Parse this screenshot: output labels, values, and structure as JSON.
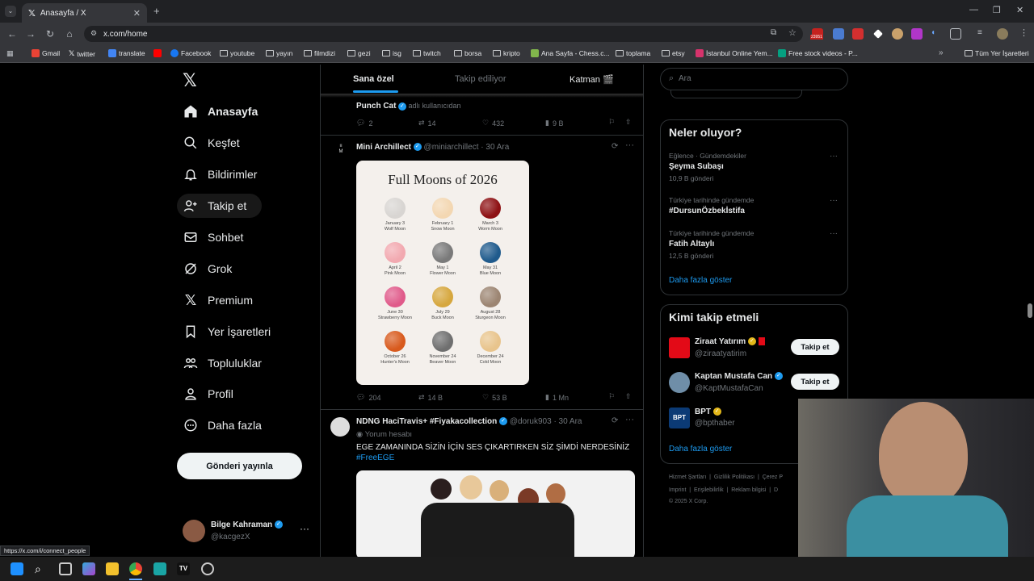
{
  "browser": {
    "tab_title": "Anasayfa / X",
    "url": "x.com/home",
    "status_url": "https://x.com/i/connect_people",
    "ext_badge": "23951",
    "bookmarks": [
      "Gmail",
      "twitter",
      "translate",
      "",
      "Facebook",
      "youtube",
      "yayın",
      "filmdizi",
      "gezi",
      "isg",
      "twitch",
      "borsa",
      "kripto",
      "Ana Sayfa - Chess.c...",
      "toplama",
      "etsy",
      "İstanbul Online Yem...",
      "Free stock videos - P..."
    ],
    "all_bookmarks": "Tüm Yer İşaretleri"
  },
  "nav": {
    "items": [
      "Anasayfa",
      "Keşfet",
      "Bildirimler",
      "Takip et",
      "Sohbet",
      "Grok",
      "Premium",
      "Yer İşaretleri",
      "Topluluklar",
      "Profil",
      "Daha fazla"
    ],
    "post_button": "Gönderi yayınla",
    "user_name": "Bilge Kahraman",
    "user_handle": "@kacgezX"
  },
  "feed": {
    "tabs": [
      "Sana özel",
      "Takip ediliyor",
      "Katman 🎬"
    ],
    "tweet0": {
      "name": "Punch Cat",
      "handle": "adlı kullanıcıdan",
      "replies": "2",
      "retweets": "14",
      "likes": "432",
      "views": "9 B"
    },
    "tweet1": {
      "name": "Mini Archillect",
      "handle": "@miniarchillect",
      "date": "· 30 Ara",
      "replies": "204",
      "retweets": "14 B",
      "likes": "53 B",
      "views": "1 Mn",
      "image_title": "Full Moons of 2026",
      "moons": [
        {
          "date": "January 3",
          "name": "Wolf Moon",
          "color": "#d8d5d2"
        },
        {
          "date": "February 1",
          "name": "Snow Moon",
          "color": "#f3d7b2"
        },
        {
          "date": "March 3",
          "name": "Worm Moon",
          "color": "#8e1114"
        },
        {
          "date": "April 2",
          "name": "Pink Moon",
          "color": "#f2a9b0"
        },
        {
          "date": "May 1",
          "name": "Flower Moon",
          "color": "#7a7a7a"
        },
        {
          "date": "May 31",
          "name": "Blue Moon",
          "color": "#1f5a8c"
        },
        {
          "date": "June 30",
          "name": "Strawberry Moon",
          "color": "#e05a8a"
        },
        {
          "date": "July 29",
          "name": "Buck Moon",
          "color": "#d6a73e"
        },
        {
          "date": "August 28",
          "name": "Sturgeon Moon",
          "color": "#9c8572"
        },
        {
          "date": "October 26",
          "name": "Hunter's Moon",
          "color": "#d85a1d"
        },
        {
          "date": "November 24",
          "name": "Beaver Moon",
          "color": "#6f6f6f"
        },
        {
          "date": "December 24",
          "name": "Cold Moon",
          "color": "#e8c48c"
        }
      ]
    },
    "tweet2": {
      "name": "NDNG HaciTravis+ #Fiyakacollection",
      "handle": "@doruk903",
      "date": "· 30 Ara",
      "sub": "Yorum hesabı",
      "text": "EGE ZAMANINDA SİZİN İÇİN SES ÇIKARTIRKEN SİZ ŞİMDİ NERDESİNİZ",
      "hashtag": "#FreeEGE"
    }
  },
  "right": {
    "search_placeholder": "Ara",
    "trends_title": "Neler oluyor?",
    "trends": [
      {
        "meta": "Eğlence · Gündemdekiler",
        "title": "Şeyma Subaşı",
        "count": "10,9 B gönderi"
      },
      {
        "meta": "Türkiye tarihinde gündemde",
        "title": "#DursunÖzbekİstifa",
        "count": ""
      },
      {
        "meta": "Türkiye tarihinde gündemde",
        "title": "Fatih Altaylı",
        "count": "12,5 B gönderi"
      }
    ],
    "show_more": "Daha fazla göster",
    "who_title": "Kimi takip etmeli",
    "who": [
      {
        "name": "Ziraat Yatırım",
        "handle": "@ziraatyatirim",
        "button": "Takip et"
      },
      {
        "name": "Kaptan Mustafa Can",
        "handle": "@KaptMustafaCan",
        "button": "Takip et"
      },
      {
        "name": "BPT",
        "handle": "@bpthaber",
        "button": "Takip et"
      }
    ],
    "footer1": [
      "Hizmet Şartları",
      "Gizlilik Politikası",
      "Çerez P"
    ],
    "footer2": [
      "Imprint",
      "Erişilebilirlik",
      "Reklam bilgisi",
      "D"
    ],
    "copyright": "© 2025 X Corp."
  },
  "colors": {
    "accent": "#1d9bf0",
    "bg": "#000000",
    "border": "#2f3336",
    "muted": "#71767b"
  }
}
